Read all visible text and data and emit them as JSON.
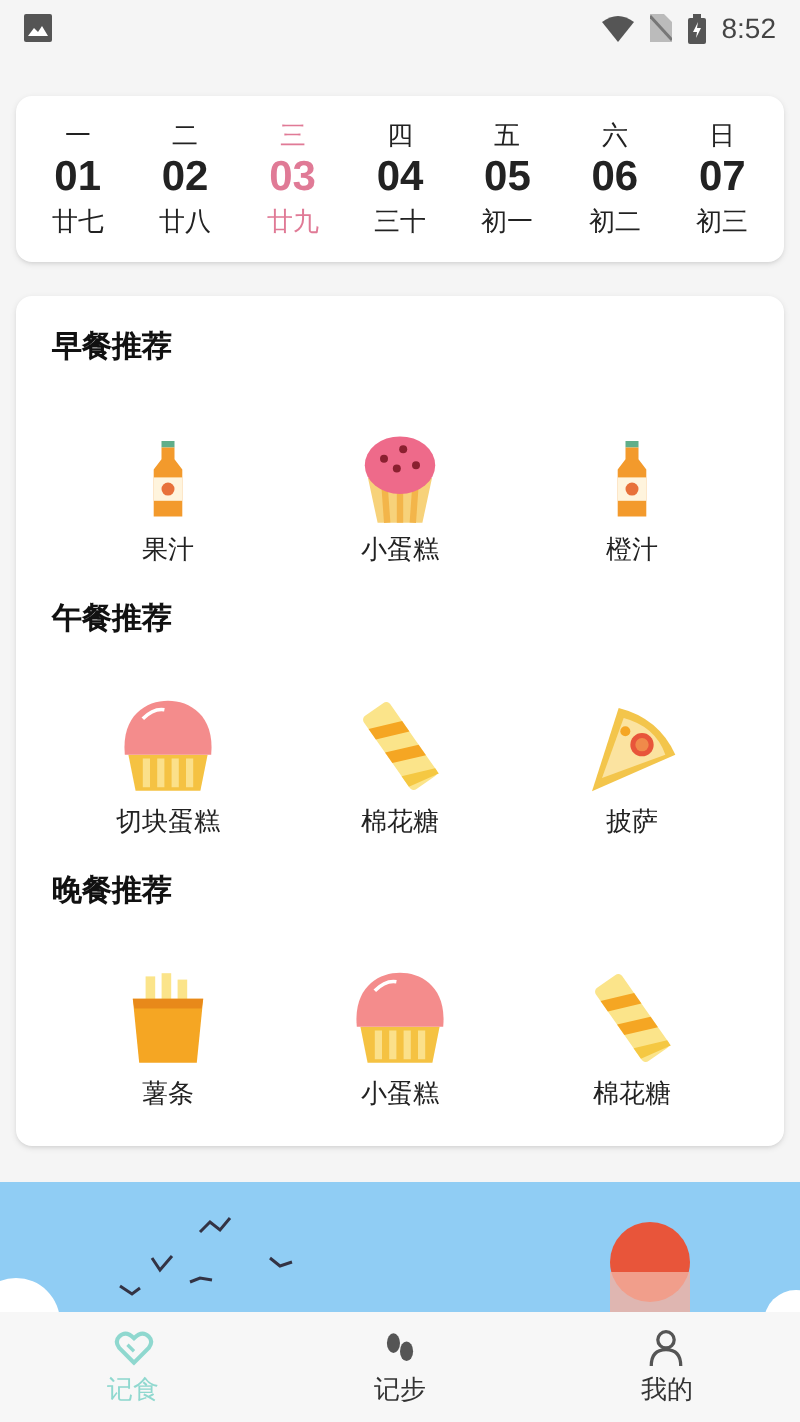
{
  "status_bar": {
    "time": "8:52"
  },
  "week": [
    {
      "weekday": "一",
      "date": "01",
      "lunar": "廿七",
      "selected": false
    },
    {
      "weekday": "二",
      "date": "02",
      "lunar": "廿八",
      "selected": false
    },
    {
      "weekday": "三",
      "date": "03",
      "lunar": "廿九",
      "selected": true
    },
    {
      "weekday": "四",
      "date": "04",
      "lunar": "三十",
      "selected": false
    },
    {
      "weekday": "五",
      "date": "05",
      "lunar": "初一",
      "selected": false
    },
    {
      "weekday": "六",
      "date": "06",
      "lunar": "初二",
      "selected": false
    },
    {
      "weekday": "日",
      "date": "07",
      "lunar": "初三",
      "selected": false
    }
  ],
  "meals": [
    {
      "title": "早餐推荐",
      "items": [
        {
          "name": "果汁",
          "kind": "juice"
        },
        {
          "name": "小蛋糕",
          "kind": "muffin"
        },
        {
          "name": "橙汁",
          "kind": "juice"
        }
      ]
    },
    {
      "title": "午餐推荐",
      "items": [
        {
          "name": "切块蛋糕",
          "kind": "cupcake"
        },
        {
          "name": "棉花糖",
          "kind": "candy"
        },
        {
          "name": "披萨",
          "kind": "pizza"
        }
      ]
    },
    {
      "title": "晚餐推荐",
      "items": [
        {
          "name": "薯条",
          "kind": "fries"
        },
        {
          "name": "小蛋糕",
          "kind": "cupcake"
        },
        {
          "name": "棉花糖",
          "kind": "candy"
        }
      ]
    }
  ],
  "nav": [
    {
      "label": "记食",
      "kind": "heart",
      "selected": true
    },
    {
      "label": "记步",
      "kind": "steps",
      "selected": false
    },
    {
      "label": "我的",
      "kind": "person",
      "selected": false
    }
  ]
}
